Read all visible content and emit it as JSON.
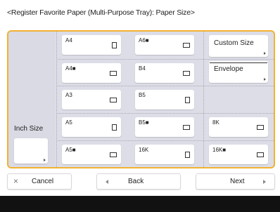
{
  "title": "<Register Favorite Paper (Multi-Purpose Tray): Paper Size>",
  "inch_size_label": "Inch Size",
  "paper_sizes": [
    {
      "label": "A4",
      "icon": "portrait-icon"
    },
    {
      "label": "A6■",
      "icon": "landscape-icon"
    },
    {
      "label": "A4■",
      "icon": "landscape-icon"
    },
    {
      "label": "B4",
      "icon": "landscape-icon"
    },
    {
      "label": "A3",
      "icon": "landscape-icon"
    },
    {
      "label": "B5",
      "icon": "portrait-icon"
    },
    {
      "label": "A5",
      "icon": "portrait-icon"
    },
    {
      "label": "B5■",
      "icon": "landscape-icon"
    },
    {
      "label": "8K",
      "icon": "landscape-icon"
    },
    {
      "label": "A5■",
      "icon": "landscape-icon"
    },
    {
      "label": "16K",
      "icon": "portrait-icon"
    },
    {
      "label": "16K■",
      "icon": "landscape-icon"
    }
  ],
  "custom_size_label": "Custom Size",
  "envelope_label": "Envelope",
  "bottom": {
    "cancel_label": "Cancel",
    "back_label": "Back",
    "next_label": "Next"
  },
  "colors": {
    "accent": "#f2b232",
    "panel_bg": "#dcdde6",
    "footer": "#111111"
  }
}
